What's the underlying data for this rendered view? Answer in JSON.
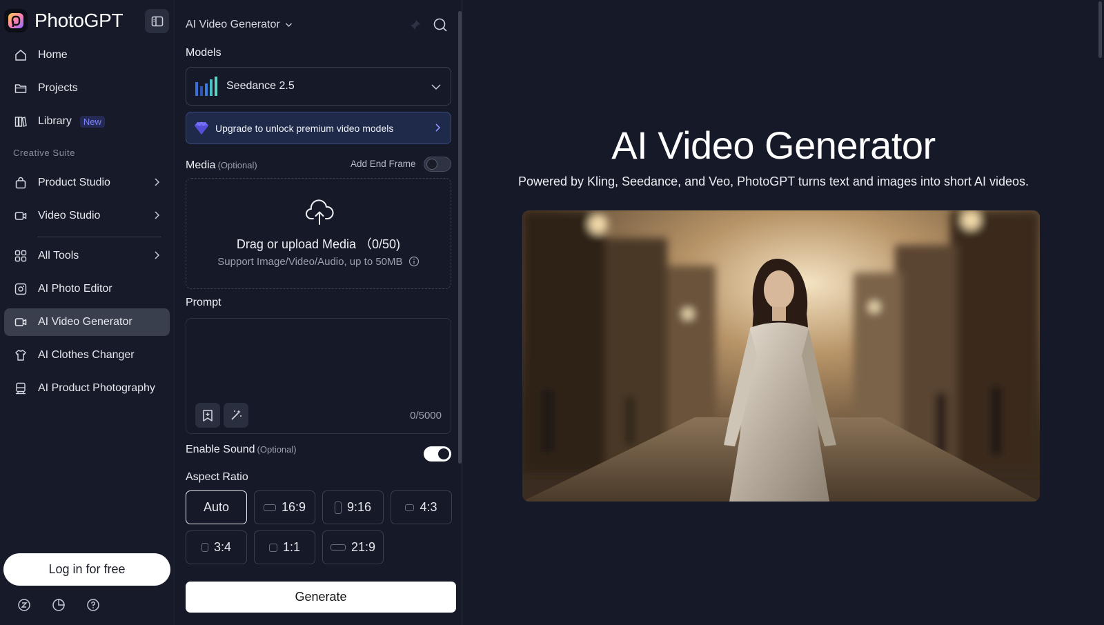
{
  "brand": {
    "name": "PhotoGPT"
  },
  "sidebar": {
    "items": [
      {
        "label": "Home"
      },
      {
        "label": "Projects"
      },
      {
        "label": "Library",
        "badge": "New"
      },
      {
        "label": "Product Studio"
      },
      {
        "label": "Video Studio"
      },
      {
        "label": "All Tools"
      },
      {
        "label": "AI Photo Editor"
      },
      {
        "label": "AI Video Generator",
        "active": true
      },
      {
        "label": "AI Clothes Changer"
      },
      {
        "label": "AI Product Photography"
      }
    ],
    "section_label": "Creative Suite",
    "login_label": "Log in for free"
  },
  "panel": {
    "title": "AI Video Generator",
    "models_label": "Models",
    "model_selected": "Seedance 2.5",
    "upgrade_text": "Upgrade to unlock premium video models",
    "media_label": "Media",
    "optional": "(Optional)",
    "add_end_frame": "Add End Frame",
    "add_end_frame_on": false,
    "upload_title": "Drag or upload Media （0/50)",
    "upload_sub": "Support Image/Video/Audio, up to 50MB",
    "prompt_label": "Prompt",
    "prompt_value": "",
    "char_count": "0/5000",
    "sound_label": "Enable Sound",
    "sound_on": true,
    "aspect_label": "Aspect Ratio",
    "ratios": [
      "Auto",
      "16:9",
      "9:16",
      "4:3",
      "3:4",
      "1:1",
      "21:9"
    ],
    "ratio_selected": "Auto",
    "generate_label": "Generate"
  },
  "main": {
    "title": "AI Video Generator",
    "subtitle": "Powered by Kling, Seedance, and Veo, PhotoGPT turns text and images into short AI videos."
  },
  "colors": {
    "background": "#161a28",
    "sidebar_active": "#3a3f4e",
    "accent_badge": "#7b83ff",
    "upgrade_bg": "#1f2a4a"
  }
}
